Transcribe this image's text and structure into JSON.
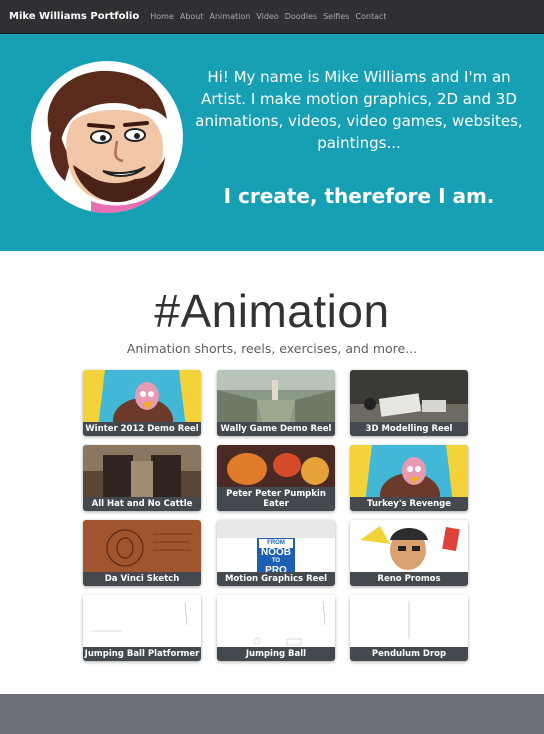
{
  "nav": {
    "brand": "Mike Williams Portfolio",
    "links": [
      "Home",
      "About",
      "Animation",
      "Video",
      "Doodles",
      "Selfies",
      "Contact"
    ]
  },
  "hero": {
    "intro": "Hi! My name is Mike Williams and I'm an Artist. I make motion graphics, 2D and 3D animations, videos, video games, websites, paintings...",
    "tagline": "I create, therefore I am.",
    "bg_color": "#179fb4"
  },
  "section": {
    "title": "#Animation",
    "subtitle": "Animation shorts, reels, exercises, and more..."
  },
  "cards": [
    {
      "caption": "Winter 2012 Demo Reel"
    },
    {
      "caption": "Wally Game Demo Reel"
    },
    {
      "caption": "3D Modelling Reel"
    },
    {
      "caption": "All Hat and No Cattle"
    },
    {
      "caption": "Peter Peter Pumpkin Eater"
    },
    {
      "caption": "Turkey's Revenge"
    },
    {
      "caption": "Da Vinci Sketch"
    },
    {
      "caption": "Motion Graphics Reel"
    },
    {
      "caption": "Reno Promos"
    },
    {
      "caption": "Jumping Ball Platformer"
    },
    {
      "caption": "Jumping Ball"
    },
    {
      "caption": "Pendulum Drop"
    }
  ],
  "thumb_text": {
    "noob_from": "FROM",
    "noob": "NOOB",
    "noob_to": "TO",
    "pro": "PRO"
  },
  "colors": {
    "navbar": "#2f3033",
    "hero": "#179fb4",
    "caption_bg": "#44494f",
    "footer": "#6b7077"
  }
}
